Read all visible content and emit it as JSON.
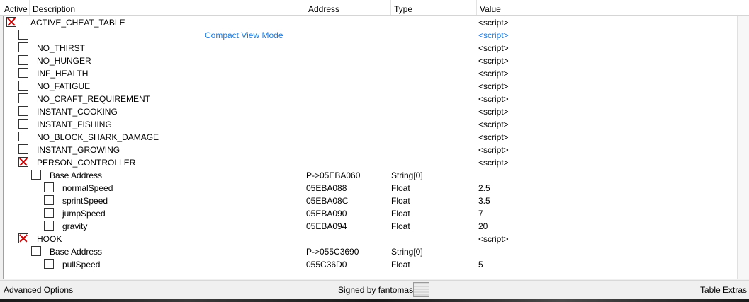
{
  "columns": {
    "active": "Active",
    "description": "Description",
    "address": "Address",
    "type": "Type",
    "value": "Value"
  },
  "rows": [
    {
      "id": "active-cheat-table",
      "desc": "ACTIVE_CHEAT_TABLE",
      "checked": true,
      "indent": 0,
      "address": "",
      "type": "",
      "value": "<script>"
    },
    {
      "id": "compact-view-mode",
      "desc": "Compact View Mode",
      "checked": false,
      "indent": 1,
      "address": "",
      "type": "",
      "value": "<script>",
      "link": true
    },
    {
      "id": "no-thirst",
      "desc": "NO_THIRST",
      "checked": false,
      "indent": 1,
      "address": "",
      "type": "",
      "value": "<script>"
    },
    {
      "id": "no-hunger",
      "desc": "NO_HUNGER",
      "checked": false,
      "indent": 1,
      "address": "",
      "type": "",
      "value": "<script>"
    },
    {
      "id": "inf-health",
      "desc": "INF_HEALTH",
      "checked": false,
      "indent": 1,
      "address": "",
      "type": "",
      "value": "<script>"
    },
    {
      "id": "no-fatigue",
      "desc": "NO_FATIGUE",
      "checked": false,
      "indent": 1,
      "address": "",
      "type": "",
      "value": "<script>"
    },
    {
      "id": "no-craft-requirement",
      "desc": "NO_CRAFT_REQUIREMENT",
      "checked": false,
      "indent": 1,
      "address": "",
      "type": "",
      "value": "<script>"
    },
    {
      "id": "instant-cooking",
      "desc": "INSTANT_COOKING",
      "checked": false,
      "indent": 1,
      "address": "",
      "type": "",
      "value": "<script>"
    },
    {
      "id": "instant-fishing",
      "desc": "INSTANT_FISHING",
      "checked": false,
      "indent": 1,
      "address": "",
      "type": "",
      "value": "<script>"
    },
    {
      "id": "no-block-shark-damage",
      "desc": "NO_BLOCK_SHARK_DAMAGE",
      "checked": false,
      "indent": 1,
      "address": "",
      "type": "",
      "value": "<script>"
    },
    {
      "id": "instant-growing",
      "desc": "INSTANT_GROWING",
      "checked": false,
      "indent": 1,
      "address": "",
      "type": "",
      "value": "<script>"
    },
    {
      "id": "person-controller",
      "desc": "PERSON_CONTROLLER",
      "checked": true,
      "indent": 1,
      "address": "",
      "type": "",
      "value": "<script>"
    },
    {
      "id": "base-address-1",
      "desc": "Base Address",
      "checked": false,
      "indent": 2,
      "address": "P->05EBA060",
      "type": "String[0]",
      "value": ""
    },
    {
      "id": "normal-speed",
      "desc": "normalSpeed",
      "checked": false,
      "indent": 3,
      "address": "05EBA088",
      "type": "Float",
      "value": "2.5"
    },
    {
      "id": "sprint-speed",
      "desc": "sprintSpeed",
      "checked": false,
      "indent": 3,
      "address": "05EBA08C",
      "type": "Float",
      "value": "3.5"
    },
    {
      "id": "jump-speed",
      "desc": "jumpSpeed",
      "checked": false,
      "indent": 3,
      "address": "05EBA090",
      "type": "Float",
      "value": "7"
    },
    {
      "id": "gravity",
      "desc": "gravity",
      "checked": false,
      "indent": 3,
      "address": "05EBA094",
      "type": "Float",
      "value": "20"
    },
    {
      "id": "hook",
      "desc": "HOOK",
      "checked": true,
      "indent": 1,
      "address": "",
      "type": "",
      "value": "<script>"
    },
    {
      "id": "base-address-2",
      "desc": "Base Address",
      "checked": false,
      "indent": 2,
      "address": "P->055C3690",
      "type": "String[0]",
      "value": ""
    },
    {
      "id": "pull-speed",
      "desc": "pullSpeed",
      "checked": false,
      "indent": 3,
      "address": "055C36D0",
      "type": "Float",
      "value": "5"
    }
  ],
  "status": {
    "advanced_options": "Advanced Options",
    "signed_by": "Signed by fantomas",
    "table_extras": "Table Extras"
  },
  "colors": {
    "check_mark": "#cc0000",
    "link": "#1e7be0"
  }
}
